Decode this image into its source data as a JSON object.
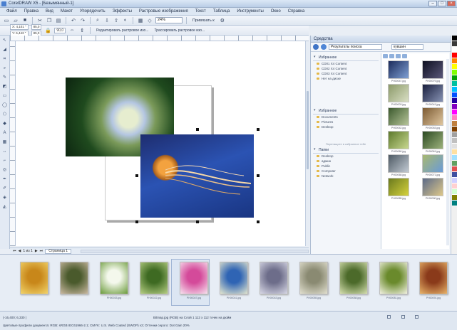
{
  "window": {
    "title": "CorelDRAW X5 - [Безымянный-1]"
  },
  "menu": [
    "Файл",
    "Правка",
    "Вид",
    "Макет",
    "Упорядочить",
    "Эффекты",
    "Растровые изображения",
    "Текст",
    "Таблица",
    "Инструменты",
    "Окно",
    "Справка"
  ],
  "toolbar": {
    "zoom_value": "24%",
    "snap_label": "Привязать к"
  },
  "property_bar": {
    "x": "X: 4,101 \"",
    "y": "Y: 6,443 \"",
    "w": "85,0",
    "h": "85,0",
    "angle": "90,0",
    "rotate_label": "Редактировать растровое изо...",
    "trace_label": "Трассировать растровое изо..."
  },
  "page_tabs": {
    "counter": "1 из 1",
    "page_tab": "Страница 1"
  },
  "docker": {
    "title": "Средства",
    "breadcrumb": "Результаты поиска",
    "search_value": "кувшин",
    "tree": {
      "section1": "Избранное",
      "section1_items": [
        "CD01 X4 Content",
        "CD02 X4 Content",
        "CD03 X4 Content",
        "Нет на диске"
      ],
      "section2": "Избранное",
      "section2_items": [
        "Documents",
        "Pictures",
        "Desktop"
      ],
      "hint": "Перетащите в избранное тебе",
      "section3": "Папки",
      "section3_items": [
        "Desktop",
        "админ",
        "Public",
        "Computer",
        "Network"
      ]
    },
    "thumbs": [
      {
        "cap": "PH00047.jpg",
        "c1": "#1c2c5c",
        "c2": "#7fa0d4"
      },
      {
        "cap": "PH00079.jpg",
        "c1": "#0e1020",
        "c2": "#5b587a"
      },
      {
        "cap": "PH00003.jpg",
        "c1": "#8c9a6a",
        "c2": "#d9dfc4"
      },
      {
        "cap": "PH00041.jpg",
        "c1": "#1a1f3e",
        "c2": "#8793b4"
      },
      {
        "cap": "PH00042.jpg",
        "c1": "#3c5a2e",
        "c2": "#b7c59a"
      },
      {
        "cap": "PH00053.jpg",
        "c1": "#7c5a32",
        "c2": "#e0c7a0"
      },
      {
        "cap": "PH00060.jpg",
        "c1": "#5e7a2c",
        "c2": "#c8d890"
      },
      {
        "cap": "PH00061.jpg",
        "c1": "#2c4a22",
        "c2": "#9cb27c"
      },
      {
        "cap": "PH00068.jpg",
        "c1": "#4e5a64",
        "c2": "#c2cad3"
      },
      {
        "cap": "PH00071.jpg",
        "c1": "#a8b870",
        "c2": "#6a9bd8"
      },
      {
        "cap": "PH00085.jpg",
        "c1": "#6a7a1e",
        "c2": "#d6d23c"
      },
      {
        "cap": "PH00090.jpg",
        "c1": "#5b6a88",
        "c2": "#dec88a"
      }
    ]
  },
  "filmstrip": [
    {
      "cap": "",
      "c1": "#c8871a",
      "c2": "#f2d46a"
    },
    {
      "cap": "",
      "c1": "#4a5a2c",
      "c2": "#c9b8a0"
    },
    {
      "cap": "PH00033.jpg",
      "c1": "#f4f8ec",
      "c2": "#6a9a3a"
    },
    {
      "cap": "PH00022.jpg",
      "c1": "#3e6a22",
      "c2": "#b7cf84"
    },
    {
      "cap": "PH00047.jpg",
      "c1": "#d44a9a",
      "c2": "#f7e2ef"
    },
    {
      "cap": "PH00041.jpg",
      "c1": "#2f64b4",
      "c2": "#e3e6cf"
    },
    {
      "cap": "PH00043.jpg",
      "c1": "#6d6d8a",
      "c2": "#d8d8e6"
    },
    {
      "cap": "PH00055.jpg",
      "c1": "#8a8a72",
      "c2": "#e2e0d0"
    },
    {
      "cap": "PH00058.jpg",
      "c1": "#4c6a2a",
      "c2": "#d6e0b0"
    },
    {
      "cap": "PH00081.jpg",
      "c1": "#6a8a2c",
      "c2": "#f2f2e2"
    },
    {
      "cap": "PH00091.jpg",
      "c1": "#8a3a1a",
      "c2": "#e9b46a"
    }
  ],
  "palette": [
    "#000000",
    "#3a3a3a",
    "#ffffff",
    "#ff0000",
    "#ff7f00",
    "#ffff00",
    "#7fff00",
    "#00a000",
    "#00c0a0",
    "#00c0ff",
    "#0050ff",
    "#2000a0",
    "#8000c0",
    "#ff00ff",
    "#ff80c0",
    "#c08040",
    "#804000",
    "#a0a0a0",
    "#c0c0c0",
    "#e0e0e0",
    "#ffe0a0",
    "#a0e0ff",
    "#60a060",
    "#e05050",
    "#4050a0",
    "#d0d0ff",
    "#ffd0d0",
    "#d0ffd0",
    "#808000",
    "#008080"
  ],
  "status": {
    "coords": "(-16,400; 6,330 )",
    "selection": "Bitmap.jpg (RGB) на Слой 1 112 x 112 точек на дюйм",
    "profile": "Цветовые профили документа: RGB: sRGB IEC61966-2.1; CMYK: U.S. Web Coated (SWOP) v2; Оттенки серого: Dot Gain 20%"
  }
}
